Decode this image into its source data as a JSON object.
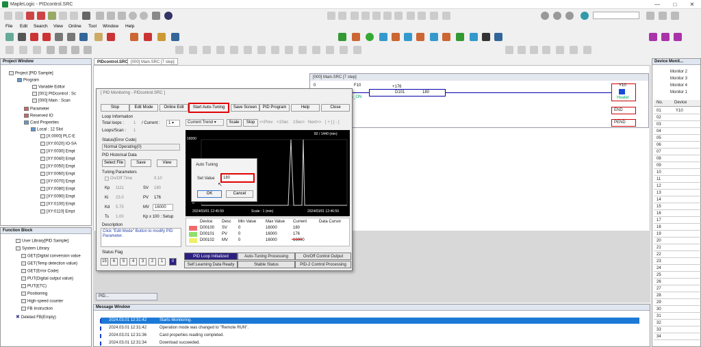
{
  "app": {
    "title": "MapleLogic - PIDcontrol.SRC"
  },
  "menus": [
    "File",
    "Edit",
    "Search",
    "View",
    "Online",
    "Tool",
    "Window",
    "Help"
  ],
  "project_window": {
    "title": "Project Window",
    "items": [
      "Project [PID Sample]",
      "Program",
      "Variable Editor",
      "[001] PIDcontrol : Sc",
      "[000] Main : Scan",
      "Parameter",
      "Reserved IO",
      "Card Properties",
      "Local : 12 Slot",
      "[X:0000] PLC-E",
      "[XY:0020] IO-SA",
      "[XY:0030] Empt",
      "[XY:0040] Empt",
      "[XY:0050] Empt",
      "[XY:0060] Empt",
      "[XY:0070] Empt",
      "[XY:0080] Empt",
      "[XY:0090] Empt",
      "[XY:0100] Empt",
      "[XY:0110] Empt"
    ]
  },
  "function_block": {
    "title": "Function Block",
    "items": [
      "User Library[PID Sample]",
      "System Library",
      "GET(Digital conversion value",
      "GET(Temp detection value)",
      "GET(Error Code)",
      "PUT(Digital output value)",
      "PUT(ETC)",
      "Positioning",
      "High-speed counter",
      "FB Instruction",
      "Deleted FB(Empty)"
    ]
  },
  "tabs": [
    "PIDcontrol.SRC",
    "[000] Main.SRC [7 step]"
  ],
  "ladder": {
    "title": "[000] Main.SRC [7 step]",
    "row0": "0",
    "f10": "F10",
    "k176": "+176",
    "d101": "D101",
    "v180": "180",
    "son": "s_ON",
    "y10": "Y10",
    "heater": "Heater",
    "end": "END",
    "pend": "PEND"
  },
  "pid": {
    "title": "[ PID Monitoring - PIDcontrol.SRC ]",
    "buttons": {
      "stop": "Stop",
      "edit": "Edit Mode",
      "online": "Online Edit",
      "autotune": "Start Auto-Tuning",
      "save": "Save Screen",
      "program": "PID Program",
      "help": "Help",
      "close": "Close"
    },
    "loop_info": "Loop Information",
    "total_loops": "Total loops :",
    "total_val": "1",
    "current": "/ Current :",
    "current_val": "1",
    "loops_scan": "Loops/Scan :",
    "loops_scan_val": "1",
    "status_label": "Status(Error Code)",
    "status_val": "Normal Operating(0)",
    "hist_label": "PID Historical Data",
    "select_file": "Select File",
    "save": "Save",
    "view": "View",
    "tuning": "Tuning Parameters",
    "onoff": "On/Off Time",
    "onoff_val": "0.10",
    "kp": "Kp",
    "kp_val": "1111",
    "sv": "SV",
    "sv_val": "180",
    "ki": "Ki",
    "ki_val": "23.0",
    "pv": "PV",
    "pv_val": "176",
    "kd": "Kd",
    "kd_val": "5.75",
    "mv": "MV",
    "mv_val": "16000",
    "ts": "Ts",
    "ts_val": "1.00",
    "kpx": "Kp x 100 : Setup",
    "desc_label": "Description",
    "desc_text": "Click \"Edit Mode\" Button to modify PID Parameter.",
    "flag_label": "Status Flag",
    "flags": [
      "15",
      "6",
      "5",
      "4",
      "3",
      "2",
      "1",
      "0"
    ],
    "trend_sel": "Current Trend",
    "scale": "Scale",
    "stop2": "Stop",
    "prev": "<<Prev",
    "m1": "<1Sec",
    "s1": "1Sec>",
    "next": "Next>>",
    "plusminus": "[ + ] [ - ]",
    "graph_top": "16000",
    "graph_bot": "0",
    "graph_counter": "82 / 1440 (min)",
    "time_left": "2024/03/01 12:45:59",
    "scale_txt": "Scale : 1 (min)",
    "time_right": "2024/03/01 12:46:59",
    "table_headers": [
      "Device",
      "Desc",
      "Min Value",
      "Max Value",
      "Current",
      "Data Cursor"
    ],
    "table_rows": [
      [
        "D00100",
        "SV",
        "0",
        "16000",
        "180",
        ""
      ],
      [
        "D00101",
        "PV",
        "0",
        "16000",
        "176",
        ""
      ],
      [
        "D00102",
        "MV",
        "0",
        "16000",
        "16000",
        ""
      ]
    ],
    "row_colors": [
      "#f26b6b",
      "#8ee06a",
      "#eef06a"
    ],
    "status_buttons": [
      "PID Loop Initialized",
      "Auto-Tuning Processing",
      "On/Off Control Output",
      "Self Learning Data Ready",
      "Stable Status",
      "PID-2 Control Processing"
    ]
  },
  "auto_tuning": {
    "title": "Auto Tuning",
    "set_label": "Set Value",
    "set_value": "180",
    "ok": "OK",
    "cancel": "Cancel"
  },
  "device_monitor": {
    "title": "Device Monit...",
    "tabs": [
      "Monitor 2",
      "Monitor 3",
      "Monitor 4",
      "Monitor 1"
    ],
    "col_no": "No.",
    "col_dev": "Device",
    "rows": [
      [
        "01",
        "Y10"
      ],
      [
        "02",
        ""
      ],
      [
        "03",
        ""
      ],
      [
        "04",
        ""
      ],
      [
        "05",
        ""
      ],
      [
        "06",
        ""
      ],
      [
        "07",
        ""
      ],
      [
        "08",
        ""
      ],
      [
        "09",
        ""
      ],
      [
        "10",
        ""
      ],
      [
        "11",
        ""
      ],
      [
        "12",
        ""
      ],
      [
        "13",
        ""
      ],
      [
        "14",
        ""
      ],
      [
        "15",
        ""
      ],
      [
        "16",
        ""
      ],
      [
        "17",
        ""
      ],
      [
        "18",
        ""
      ],
      [
        "19",
        ""
      ],
      [
        "20",
        ""
      ],
      [
        "21",
        ""
      ],
      [
        "22",
        ""
      ],
      [
        "23",
        ""
      ],
      [
        "24",
        ""
      ],
      [
        "25",
        ""
      ],
      [
        "26",
        ""
      ],
      [
        "27",
        ""
      ],
      [
        "28",
        ""
      ],
      [
        "29",
        ""
      ],
      [
        "30",
        ""
      ],
      [
        "31",
        ""
      ],
      [
        "32",
        ""
      ],
      [
        "33",
        ""
      ],
      [
        "34",
        ""
      ]
    ]
  },
  "message_window": {
    "title": "Message Window",
    "rows": [
      [
        "2024.03.01 12:31:42",
        "Starts Monitoring."
      ],
      [
        "2024.03.01 12:31:42",
        "Operation mode was changed to \"Remote RUN\"."
      ],
      [
        "2024.03.01 12:31:36",
        "Card properties reading completed."
      ],
      [
        "2024.03.01 12:31:34",
        "Download succeeded."
      ]
    ]
  },
  "minimized_tab": "PID..."
}
